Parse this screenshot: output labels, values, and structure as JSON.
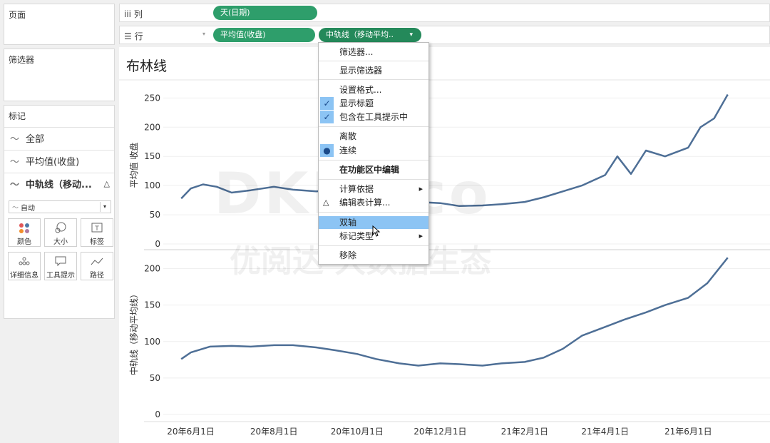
{
  "panels": {
    "pages_title": "页面",
    "filters_title": "筛选器",
    "marks_title": "标记",
    "marks_items": [
      "全部",
      "平均值(收盘)",
      "中轨线（移动..."
    ],
    "mark_type": "自动",
    "mark_buttons": [
      "颜色",
      "大小",
      "标签",
      "详细信息",
      "工具提示",
      "路径"
    ]
  },
  "shelves": {
    "columns_label": "列",
    "rows_label": "行",
    "columns_pill": "天(日期)",
    "rows_pill_1": "平均值(收盘)",
    "rows_pill_2": "中轨线（移动平均.."
  },
  "view": {
    "title": "布林线"
  },
  "context_menu": {
    "items": [
      "筛选器...",
      "显示筛选器",
      "设置格式...",
      "显示标题",
      "包含在工具提示中",
      "离散",
      "连续",
      "在功能区中编辑",
      "计算依据",
      "编辑表计算...",
      "双轴",
      "标记类型",
      "移除"
    ],
    "highlighted": "双轴"
  },
  "watermark": {
    "text1": "DKMeco",
    "text2": "优阅达 大数据生态"
  },
  "chart_data": [
    {
      "type": "line",
      "ylabel": "平均值 收盘",
      "yticks": [
        0,
        50,
        100,
        150,
        200,
        250
      ],
      "ylim": [
        0,
        270
      ],
      "color": "#4e6f96",
      "grid": true,
      "x": [
        "2020-05-25",
        "2020-06-01",
        "2020-06-10",
        "2020-06-20",
        "2020-07-01",
        "2020-07-15",
        "2020-08-01",
        "2020-08-15",
        "2020-09-01",
        "2020-09-15",
        "2020-10-01",
        "2020-10-15",
        "2020-11-01",
        "2020-11-15",
        "2020-12-01",
        "2020-12-15",
        "2021-01-01",
        "2021-01-15",
        "2021-02-01",
        "2021-02-15",
        "2021-03-01",
        "2021-03-15",
        "2021-04-01",
        "2021-04-10",
        "2021-04-20",
        "2021-05-01",
        "2021-05-15",
        "2021-06-01",
        "2021-06-10",
        "2021-06-20",
        "2021-06-30"
      ],
      "values": [
        78,
        95,
        102,
        98,
        88,
        92,
        98,
        93,
        90,
        92,
        85,
        80,
        75,
        72,
        70,
        65,
        66,
        68,
        72,
        80,
        90,
        100,
        118,
        150,
        120,
        160,
        150,
        165,
        200,
        215,
        256
      ]
    },
    {
      "type": "line",
      "ylabel": "中轨线（移动平均线）",
      "yticks": [
        0,
        50,
        100,
        150,
        200
      ],
      "ylim": [
        0,
        225
      ],
      "color": "#4e6f96",
      "grid": true,
      "xticks": [
        "20年6月1日",
        "20年8月1日",
        "20年10月1日",
        "20年12月1日",
        "21年2月1日",
        "21年4月1日",
        "21年6月1日"
      ],
      "x": [
        "2020-05-25",
        "2020-06-01",
        "2020-06-15",
        "2020-07-01",
        "2020-07-15",
        "2020-08-01",
        "2020-08-15",
        "2020-09-01",
        "2020-09-15",
        "2020-10-01",
        "2020-10-15",
        "2020-11-01",
        "2020-11-15",
        "2020-12-01",
        "2020-12-15",
        "2021-01-01",
        "2021-01-15",
        "2021-02-01",
        "2021-02-15",
        "2021-03-01",
        "2021-03-15",
        "2021-04-01",
        "2021-04-15",
        "2021-05-01",
        "2021-05-15",
        "2021-06-01",
        "2021-06-15",
        "2021-06-30"
      ],
      "values": [
        76,
        85,
        93,
        94,
        93,
        95,
        95,
        92,
        88,
        83,
        76,
        70,
        67,
        70,
        69,
        67,
        70,
        72,
        78,
        90,
        108,
        120,
        130,
        140,
        150,
        160,
        180,
        215
      ]
    }
  ]
}
